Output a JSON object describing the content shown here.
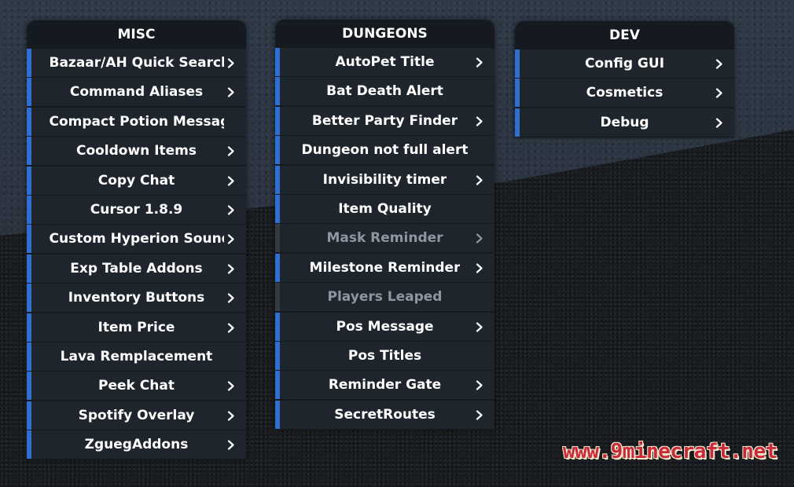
{
  "panels": {
    "misc": {
      "title": "MISC",
      "items": [
        {
          "label": "Bazaar/AH Quick Search",
          "enabled": true,
          "has_submenu": true
        },
        {
          "label": "Command Aliases",
          "enabled": true,
          "has_submenu": true
        },
        {
          "label": "Compact Potion Message",
          "enabled": true,
          "has_submenu": false
        },
        {
          "label": "Cooldown Items",
          "enabled": true,
          "has_submenu": true
        },
        {
          "label": "Copy Chat",
          "enabled": true,
          "has_submenu": true
        },
        {
          "label": "Cursor 1.8.9",
          "enabled": true,
          "has_submenu": true
        },
        {
          "label": "Custom Hyperion Sound",
          "enabled": true,
          "has_submenu": true
        },
        {
          "label": "Exp Table Addons",
          "enabled": true,
          "has_submenu": true
        },
        {
          "label": "Inventory Buttons",
          "enabled": true,
          "has_submenu": true
        },
        {
          "label": "Item Price",
          "enabled": true,
          "has_submenu": true
        },
        {
          "label": "Lava Remplacement",
          "enabled": true,
          "has_submenu": false
        },
        {
          "label": "Peek Chat",
          "enabled": true,
          "has_submenu": true
        },
        {
          "label": "Spotify Overlay",
          "enabled": true,
          "has_submenu": true
        },
        {
          "label": "ZguegAddons",
          "enabled": true,
          "has_submenu": true
        }
      ]
    },
    "dungeons": {
      "title": "DUNGEONS",
      "items": [
        {
          "label": "AutoPet Title",
          "enabled": true,
          "has_submenu": true
        },
        {
          "label": "Bat Death Alert",
          "enabled": true,
          "has_submenu": false
        },
        {
          "label": "Better Party Finder",
          "enabled": true,
          "has_submenu": true
        },
        {
          "label": "Dungeon not full alert",
          "enabled": true,
          "has_submenu": false
        },
        {
          "label": "Invisibility timer",
          "enabled": true,
          "has_submenu": true
        },
        {
          "label": "Item Quality",
          "enabled": true,
          "has_submenu": false
        },
        {
          "label": "Mask Reminder",
          "enabled": false,
          "has_submenu": true
        },
        {
          "label": "Milestone Reminder",
          "enabled": true,
          "has_submenu": true
        },
        {
          "label": "Players Leaped",
          "enabled": false,
          "has_submenu": false
        },
        {
          "label": "Pos Message",
          "enabled": true,
          "has_submenu": true
        },
        {
          "label": "Pos Titles",
          "enabled": true,
          "has_submenu": false
        },
        {
          "label": "Reminder Gate",
          "enabled": true,
          "has_submenu": true
        },
        {
          "label": "SecretRoutes",
          "enabled": true,
          "has_submenu": true
        }
      ]
    },
    "dev": {
      "title": "DEV",
      "items": [
        {
          "label": "Config GUI",
          "enabled": true,
          "has_submenu": true
        },
        {
          "label": "Cosmetics",
          "enabled": true,
          "has_submenu": true
        },
        {
          "label": "Debug",
          "enabled": true,
          "has_submenu": true
        }
      ]
    }
  },
  "watermark": "www.9minecraft.net",
  "colors": {
    "accent_enabled": "#2f6fcf",
    "accent_disabled": "#343b45",
    "row_bg": "#1f252d",
    "header_bg": "#151a21",
    "text": "#ffffff",
    "text_disabled": "#8f969f",
    "watermark": "#c8293b"
  },
  "icons": {
    "submenu": "chevron-right-icon"
  }
}
